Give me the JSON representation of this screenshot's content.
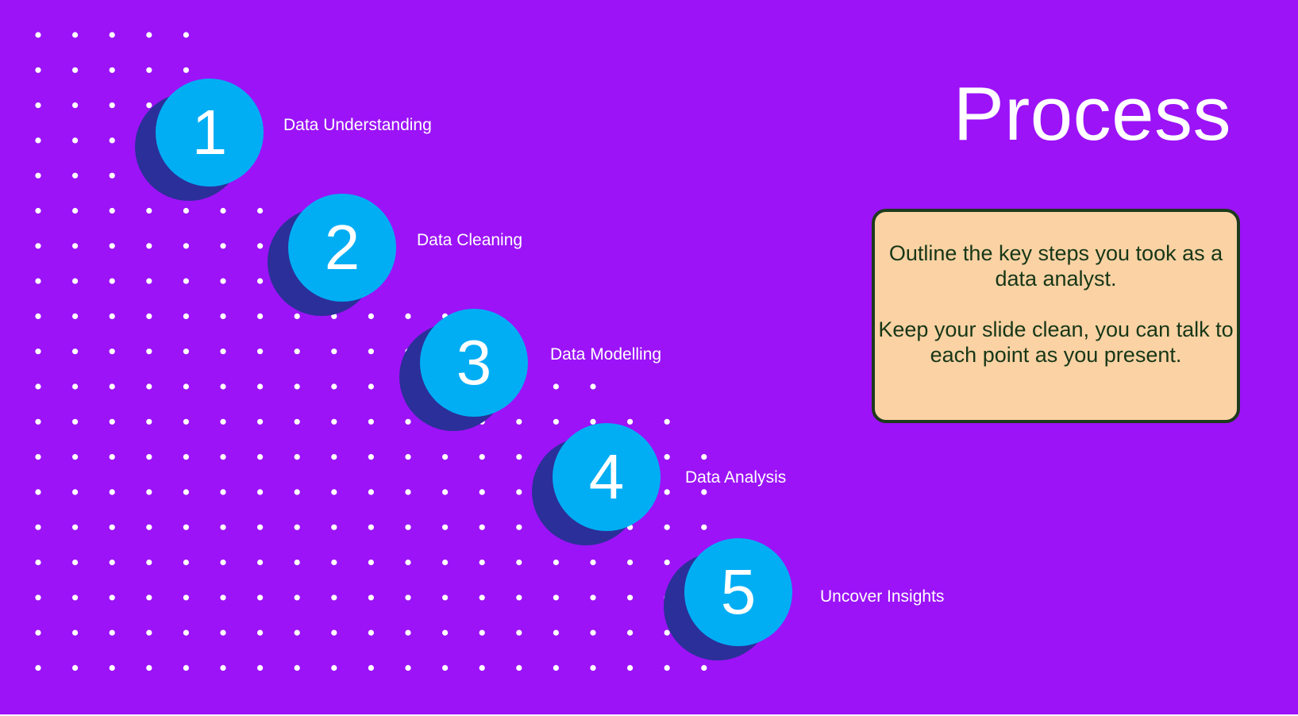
{
  "slide": {
    "title": "Process",
    "background_color": "#9c13f7",
    "steps": [
      {
        "number": "1",
        "label": "Data Understanding"
      },
      {
        "number": "2",
        "label": "Data Cleaning"
      },
      {
        "number": "3",
        "label": "Data Modelling"
      },
      {
        "number": "4",
        "label": "Data Analysis"
      },
      {
        "number": "5",
        "label": "Uncover Insights"
      }
    ],
    "note": {
      "line1": "Outline the key steps you took as a data analyst.",
      "line2": "Keep your slide clean, you can talk to each point as you present."
    },
    "colors": {
      "circle": "#01aef4",
      "circle_shadow": "#2b2f99",
      "note_fill": "#fad2a4",
      "note_border": "#1d3a1d"
    }
  }
}
